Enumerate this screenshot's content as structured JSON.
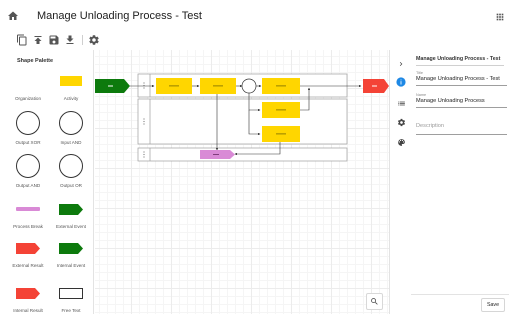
{
  "header": {
    "title": "Manage Unloading Process - Test",
    "icons": [
      "home-icon",
      "apps-grid-icon"
    ]
  },
  "toolbar": {
    "icons": [
      "copy-icon",
      "upload-icon",
      "save-icon",
      "download-icon",
      "settings-icon"
    ]
  },
  "palette": {
    "title": "Shape Palette",
    "items": [
      {
        "label": "Organization",
        "shape": "none"
      },
      {
        "label": "Activity",
        "shape": "yellow-rectangle"
      },
      {
        "label": "Output XOR",
        "shape": "circle"
      },
      {
        "label": "Input AND",
        "shape": "circle"
      },
      {
        "label": "Output AND",
        "shape": "circle"
      },
      {
        "label": "Output OR",
        "shape": "circle"
      },
      {
        "label": "Process Break",
        "shape": "pink-bar"
      },
      {
        "label": "External Event",
        "shape": "green-pentagon"
      },
      {
        "label": "External Result",
        "shape": "red-pentagon"
      },
      {
        "label": "Internal Event",
        "shape": "green-pentagon"
      },
      {
        "label": "Internal Result",
        "shape": "red-pentagon"
      },
      {
        "label": "Free Text",
        "shape": "text-box"
      }
    ]
  },
  "colors": {
    "activity": "#ffd600",
    "external_event": "#0d7a0d",
    "external_result": "#f44336",
    "process_break": "#d98ad6",
    "accent": "#1e88e5"
  },
  "side_rail": {
    "icons": [
      "chevron-right-icon",
      "info-icon",
      "list-icon",
      "settings-icon",
      "palette-icon"
    ]
  },
  "properties": {
    "title": "Manage Unloading Process - Test",
    "title_field_label": "Title",
    "title_field_value": "Manage Unloading Process - Test",
    "name_field_label": "Name",
    "name_field_value": "Manage Unloading Process",
    "description_placeholder": "Description",
    "save_label": "Save"
  },
  "zoom": {
    "icon": "search-icon"
  }
}
